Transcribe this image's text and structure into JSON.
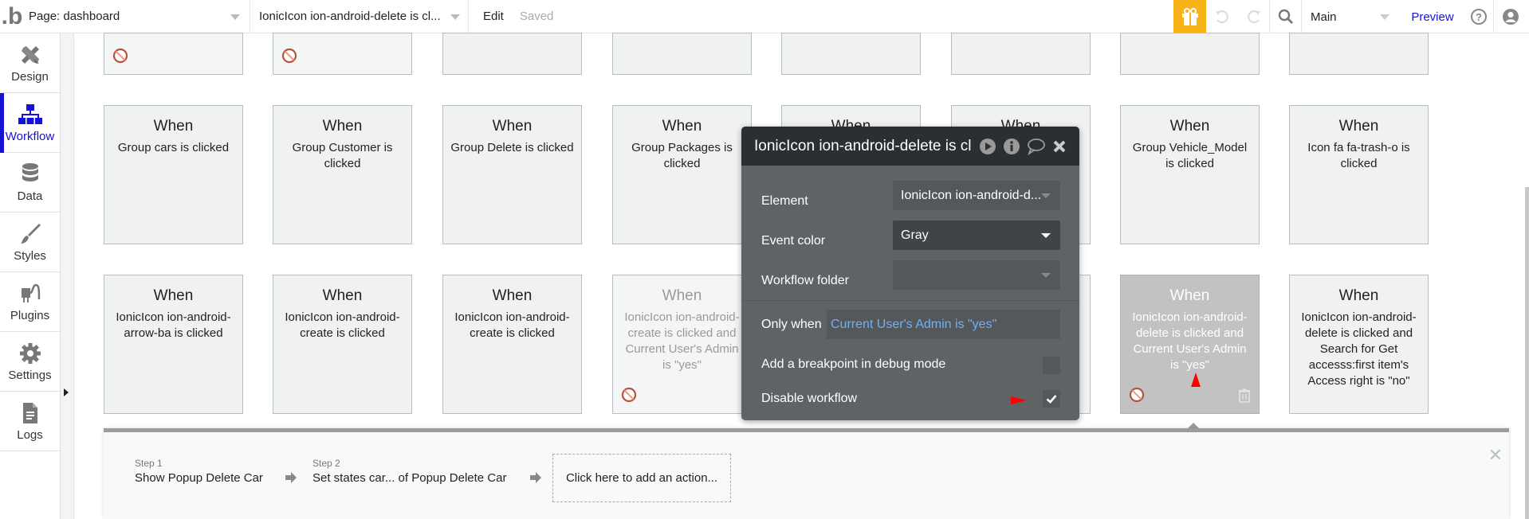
{
  "topbar": {
    "logo": ".b",
    "page_selector": "Page: dashboard",
    "workflow_selector": "IonicIcon ion-android-delete is cl...",
    "edit_label": "Edit",
    "save_status": "Saved",
    "version_selector": "Main",
    "preview_label": "Preview",
    "icons": [
      "gift-icon",
      "undo-icon",
      "redo-icon",
      "search-icon",
      "help-icon",
      "user-icon"
    ]
  },
  "sidebar": {
    "items": [
      {
        "label": "Design",
        "icon": "design-icon",
        "active": false
      },
      {
        "label": "Workflow",
        "icon": "workflow-icon",
        "active": true
      },
      {
        "label": "Data",
        "icon": "database-icon",
        "active": false
      },
      {
        "label": "Styles",
        "icon": "brush-icon",
        "active": false
      },
      {
        "label": "Plugins",
        "icon": "plug-icon",
        "active": false
      },
      {
        "label": "Settings",
        "icon": "gear-icon",
        "active": false
      },
      {
        "label": "Logs",
        "icon": "document-icon",
        "active": false
      }
    ]
  },
  "workflows": {
    "row0": [
      {
        "disabled": true
      },
      {
        "disabled": true
      },
      {},
      {},
      {},
      {},
      {},
      {}
    ],
    "row1": [
      {
        "when": "When",
        "desc": "Group cars is clicked"
      },
      {
        "when": "When",
        "desc": "Group Customer is clicked"
      },
      {
        "when": "When",
        "desc": "Group Delete is clicked"
      },
      {
        "when": "When",
        "desc": "Group Packages is clicked"
      },
      {
        "when": "When",
        "desc": ""
      },
      {
        "when": "When",
        "desc": ""
      },
      {
        "when": "When",
        "desc": "Group Vehicle_Model is clicked"
      },
      {
        "when": "When",
        "desc": "Icon fa fa-trash-o is clicked"
      }
    ],
    "row2": [
      {
        "when": "When",
        "desc": "IonicIcon ion-android-arrow-ba is clicked"
      },
      {
        "when": "When",
        "desc": "IonicIcon ion-android-create is clicked"
      },
      {
        "when": "When",
        "desc": "IonicIcon ion-android-create is clicked"
      },
      {
        "when": "When",
        "desc": "IonicIcon ion-android-create is clicked and Current User's Admin is \"yes\"",
        "disabled": true
      },
      {
        "when": "",
        "desc": ""
      },
      {
        "when": "",
        "desc": ""
      },
      {
        "when": "When",
        "desc": "IonicIcon ion-android-delete is clicked and Current User's Admin is \"yes\"",
        "disabled": true,
        "selected": true
      },
      {
        "when": "When",
        "desc": "IonicIcon ion-android-delete is clicked and Search for Get accesss:first item's Access right is \"no\""
      }
    ]
  },
  "popup": {
    "title": "IonicIcon ion-android-delete is clicked",
    "element_label": "Element",
    "element_value": "IonicIcon ion-android-d...",
    "event_color_label": "Event color",
    "event_color_value": "Gray",
    "workflow_folder_label": "Workflow folder",
    "workflow_folder_value": "",
    "only_when_label": "Only when",
    "only_when_value": "Current User's Admin is \"yes\"",
    "breakpoint_label": "Add a breakpoint in debug mode",
    "breakpoint_checked": false,
    "disable_label": "Disable workflow",
    "disable_checked": true,
    "colors": {
      "condition_text": "#6fb0f6",
      "annotation": "#ff0000"
    }
  },
  "steps": {
    "items": [
      {
        "label": "Step 1",
        "value": "Show Popup Delete Car"
      },
      {
        "label": "Step 2",
        "value": "Set states car... of Popup Delete Car"
      }
    ],
    "add_action": "Click here to add an action...",
    "close": "✕"
  },
  "colors": {
    "accent": "#1512d4",
    "gift": "#f8b319",
    "popup_bg": "#5f6366",
    "popup_header": "#2a2f31"
  }
}
